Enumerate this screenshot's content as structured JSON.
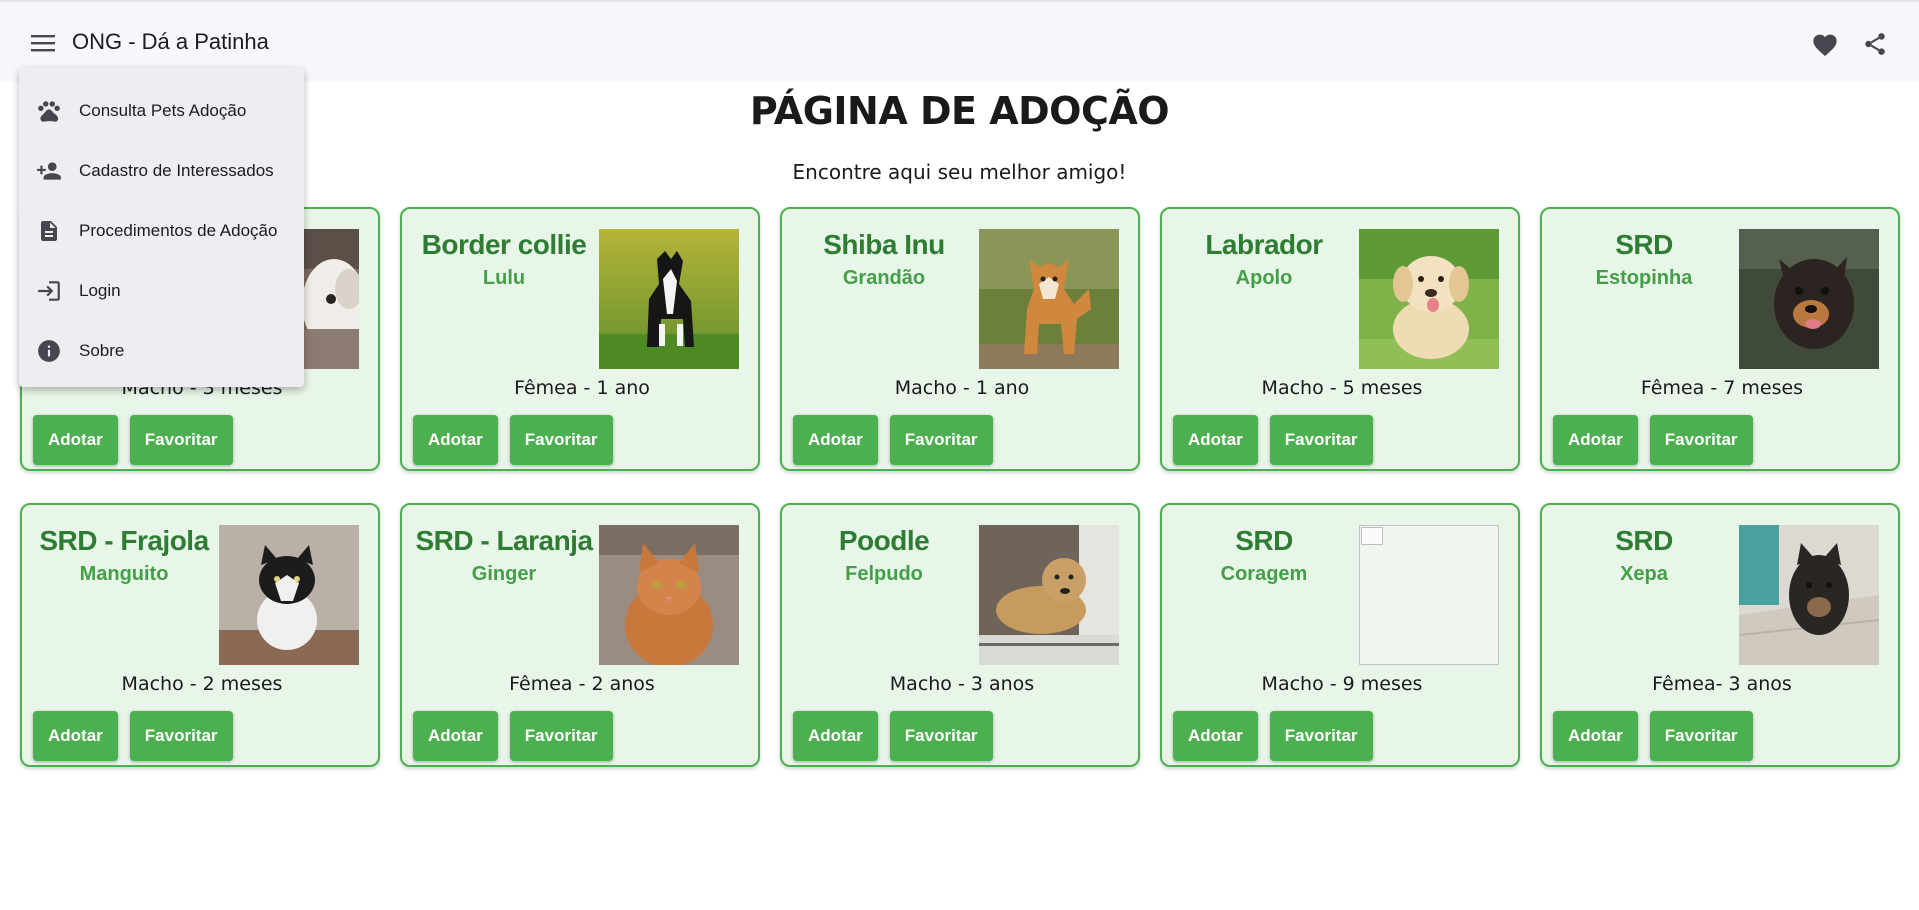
{
  "app": {
    "title": "ONG - Dá a Patinha",
    "menu_icon": "menu-icon",
    "actions": [
      {
        "icon": "heart-icon"
      },
      {
        "icon": "share-icon"
      }
    ]
  },
  "menu": {
    "items": [
      {
        "label": "Consulta Pets Adoção",
        "icon": "paw-icon"
      },
      {
        "label": "Cadastro de Interessados",
        "icon": "person-add-icon"
      },
      {
        "label": "Procedimentos de Adoção",
        "icon": "document-icon"
      },
      {
        "label": "Login",
        "icon": "login-icon"
      },
      {
        "label": "Sobre",
        "icon": "info-icon"
      }
    ]
  },
  "page": {
    "title": "PÁGINA DE ADOÇÃO",
    "subtitle": "Encontre aqui seu melhor amigo!"
  },
  "buttons": {
    "adopt": "Adotar",
    "favorite": "Favoritar"
  },
  "pets": [
    {
      "breed": "",
      "name": "",
      "info": "Macho - 3 meses",
      "photo": "shih-tzu-photo"
    },
    {
      "breed": "Border collie",
      "name": "Lulu",
      "info": "Fêmea - 1 ano",
      "photo": "border-collie-photo"
    },
    {
      "breed": "Shiba Inu",
      "name": "Grandão",
      "info": "Macho - 1 ano",
      "photo": "shiba-inu-photo"
    },
    {
      "breed": "Labrador",
      "name": "Apolo",
      "info": "Macho - 5 meses",
      "photo": "labrador-photo"
    },
    {
      "breed": "SRD",
      "name": "Estopinha",
      "info": "Fêmea - 7 meses",
      "photo": "srd-dog-photo"
    },
    {
      "breed": "SRD - Frajola",
      "name": "Manguito",
      "info": "Macho - 2 meses",
      "photo": "black-white-kitten-photo"
    },
    {
      "breed": "SRD - Laranja",
      "name": "Ginger",
      "info": "Fêmea - 2 anos",
      "photo": "orange-cat-photo"
    },
    {
      "breed": "Poodle",
      "name": "Felpudo",
      "info": "Macho - 3 anos",
      "photo": "poodle-photo"
    },
    {
      "breed": "SRD",
      "name": "Coragem",
      "info": "Macho - 9 meses",
      "photo": "broken-image"
    },
    {
      "breed": "SRD",
      "name": "Xepa",
      "info": "Fêmea- 3 anos",
      "photo": "black-dog-photo"
    }
  ],
  "colors": {
    "card_bg": "#e8f5e9",
    "card_border": "#4caf50",
    "breed_text": "#2e7d32",
    "name_text": "#43a047",
    "button": "#4caf50",
    "toolbar": "#f8f7fb"
  }
}
